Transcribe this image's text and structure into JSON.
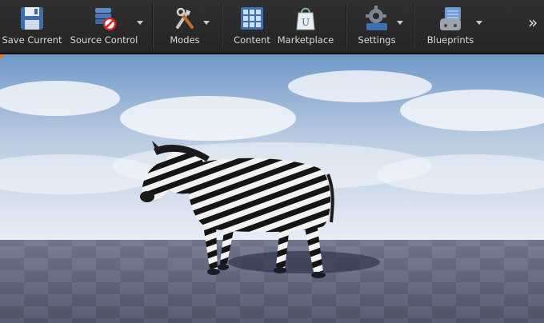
{
  "toolbar": {
    "buttons": [
      {
        "label": "Save Current",
        "icon": "floppy-disk-icon"
      },
      {
        "label": "Source Control",
        "icon": "source-control-icon"
      },
      {
        "label": "Modes",
        "icon": "modes-tools-icon"
      },
      {
        "label": "Content",
        "icon": "content-grid-icon"
      },
      {
        "label": "Marketplace",
        "icon": "marketplace-bag-icon"
      },
      {
        "label": "Settings",
        "icon": "settings-gear-icon"
      },
      {
        "label": "Blueprints",
        "icon": "blueprints-icon"
      }
    ],
    "overflow_glyph": "»"
  },
  "viewport": {
    "subject": "zebra",
    "colors": {
      "sky_top": "#6f98c8",
      "sky_bottom": "#e8edf5",
      "floor_dark": "#5b6075",
      "floor_light": "#737890"
    }
  }
}
